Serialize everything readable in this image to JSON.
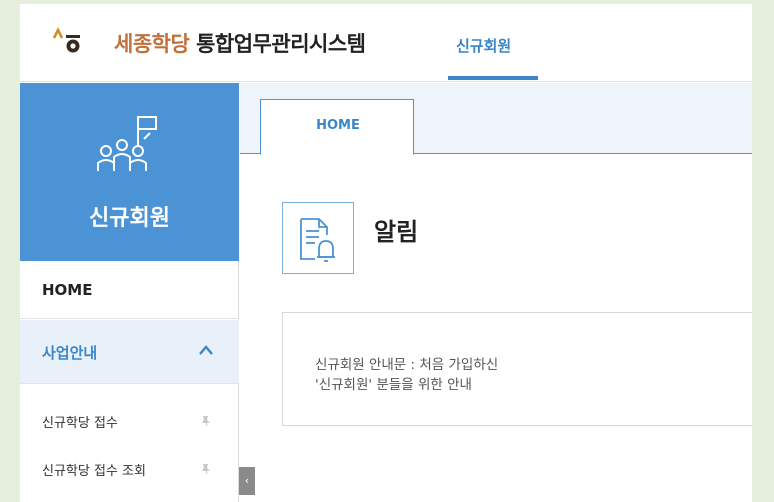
{
  "header": {
    "brand_accent": "세종학당",
    "brand_main": "통합업무관리시스템",
    "active_tab": "신규회원"
  },
  "sidebar": {
    "title": "신규회원",
    "home": "HOME",
    "section": {
      "label": "사업안내",
      "expanded": true
    },
    "items": [
      {
        "label": "신규학당 접수"
      },
      {
        "label": "신규학당 접수 조회"
      }
    ],
    "collapse_glyph": "‹"
  },
  "tabs": [
    {
      "label": "HOME",
      "active": true
    }
  ],
  "notice": {
    "title": "알림",
    "line1": "신규회원 안내문 : 처음 가입하신",
    "line2": "'신규회원' 분들을 위한 안내"
  },
  "colors": {
    "primary": "#4c93d5",
    "accent": "#c0703c",
    "background": "#e6efdc"
  }
}
